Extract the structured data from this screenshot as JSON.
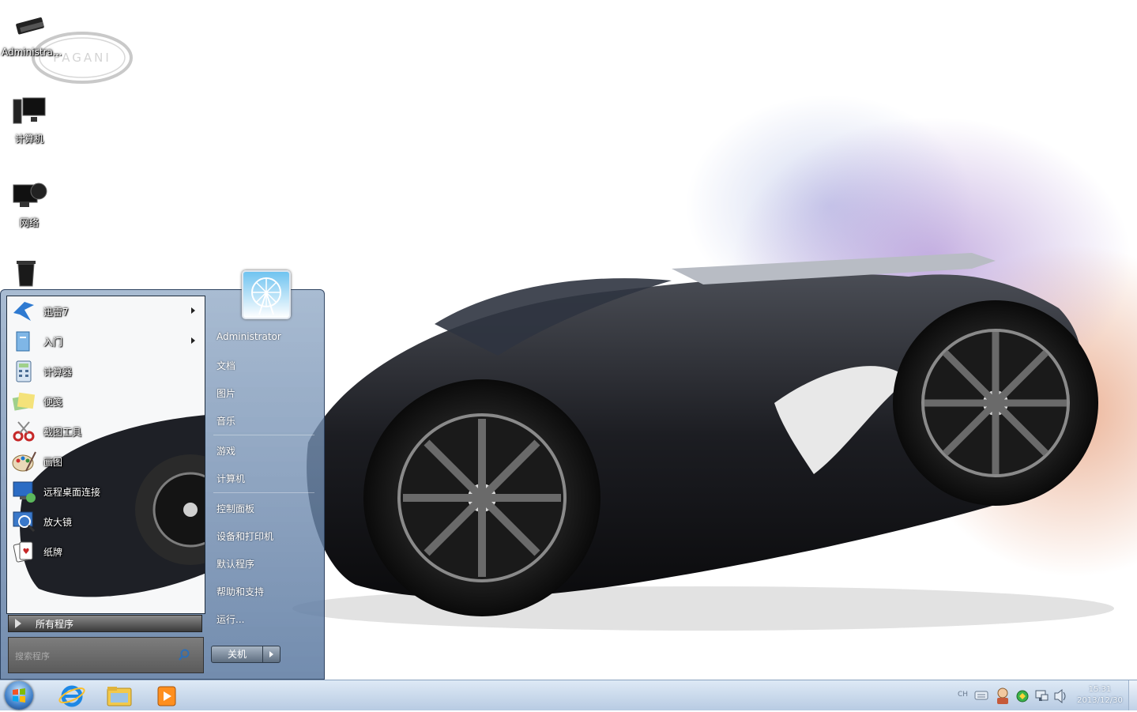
{
  "desktop": {
    "icons": [
      {
        "label": "Administra..."
      },
      {
        "label": "计算机"
      },
      {
        "label": "网络"
      },
      {
        "label": ""
      }
    ],
    "logo_text": "PAGANI"
  },
  "start_menu": {
    "programs": [
      {
        "label": "迅雷7",
        "has_submenu": true
      },
      {
        "label": "入门",
        "has_submenu": true
      },
      {
        "label": "计算器",
        "has_submenu": false
      },
      {
        "label": "便笺",
        "has_submenu": false
      },
      {
        "label": "截图工具",
        "has_submenu": false
      },
      {
        "label": "画图",
        "has_submenu": false
      },
      {
        "label": "远程桌面连接",
        "has_submenu": false
      },
      {
        "label": "放大镜",
        "has_submenu": false
      },
      {
        "label": "纸牌",
        "has_submenu": false
      }
    ],
    "all_programs": "所有程序",
    "search_placeholder": "搜索程序",
    "right_links": {
      "user": "Administrator",
      "documents": "文档",
      "pictures": "图片",
      "music": "音乐",
      "games": "游戏",
      "computer": "计算机",
      "control_panel": "控制面板",
      "devices_printers": "设备和打印机",
      "default_programs": "默认程序",
      "help_support": "帮助和支持",
      "run": "运行..."
    },
    "shutdown": "关机"
  },
  "taskbar": {
    "language": "CH",
    "time": "15:31",
    "date": "2013/12/30"
  },
  "colors": {
    "taskbar": "#c4d4e8",
    "start_menu_frame": "#6f8eb3"
  }
}
